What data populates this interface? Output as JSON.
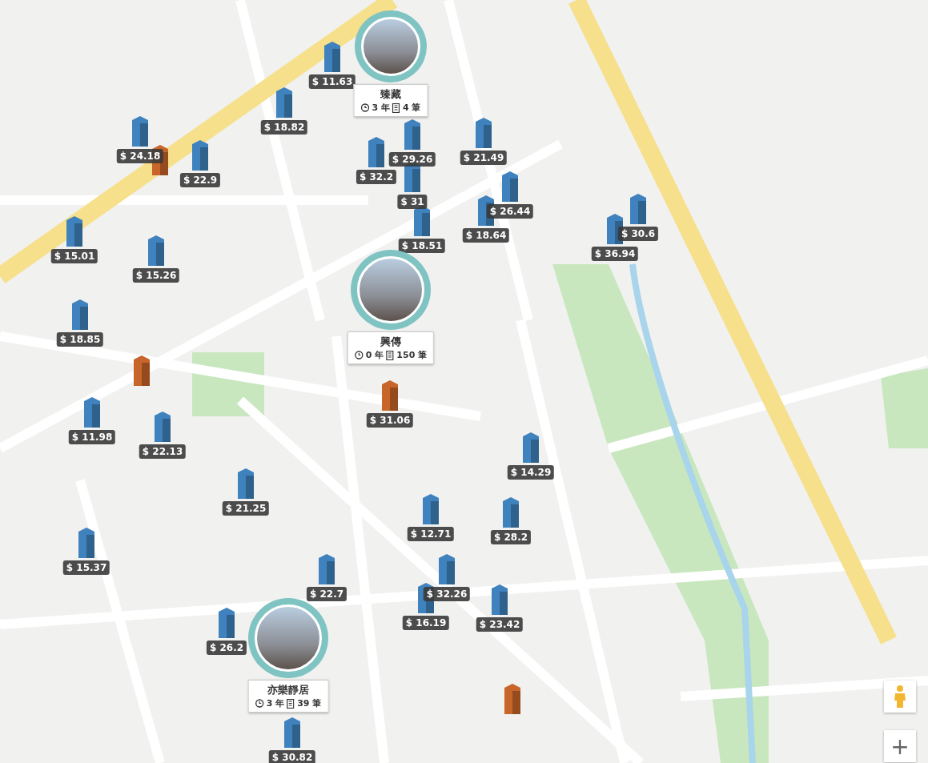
{
  "price_markers": [
    {
      "price": "$ 11.63",
      "color": "#3f82bd"
    },
    {
      "price": "$ 18.82",
      "color": "#3f82bd"
    },
    {
      "price": "$ 24.18",
      "color": "#3f82bd"
    },
    {
      "price": "$ 29.26",
      "color": "#3f82bd"
    },
    {
      "price": "$ 21.49",
      "color": "#3f82bd"
    },
    {
      "price": "$ 22.9",
      "color": "#3f82bd"
    },
    {
      "color": "#c8652a"
    },
    {
      "price": "$ 32.2",
      "color": "#3f82bd"
    },
    {
      "price": "$ 31",
      "color": "#3f82bd"
    },
    {
      "price": "$ 26.44",
      "color": "#3f82bd"
    },
    {
      "price": "$ 18.64",
      "color": "#3f82bd"
    },
    {
      "price": "$ 18.51",
      "color": "#3f82bd"
    },
    {
      "price": "$ 30.6",
      "color": "#3f82bd"
    },
    {
      "price": "$ 36.94",
      "color": "#3f82bd"
    },
    {
      "price": "$ 15.01",
      "color": "#3f82bd"
    },
    {
      "price": "$ 15.26",
      "color": "#3f82bd"
    },
    {
      "price": "$ 18.85",
      "color": "#3f82bd"
    },
    {
      "color": "#c8652a"
    },
    {
      "price": "$ 11.98",
      "color": "#3f82bd"
    },
    {
      "price": "$ 22.13",
      "color": "#3f82bd"
    },
    {
      "price": "$ 31.06",
      "color": "#c8652a"
    },
    {
      "price": "$ 14.29",
      "color": "#3f82bd"
    },
    {
      "price": "$ 21.25",
      "color": "#3f82bd"
    },
    {
      "price": "$ 12.71",
      "color": "#3f82bd"
    },
    {
      "price": "$ 28.2",
      "color": "#3f82bd"
    },
    {
      "price": "$ 15.37",
      "color": "#3f82bd"
    },
    {
      "price": "$ 22.7",
      "color": "#3f82bd"
    },
    {
      "price": "$ 32.26",
      "color": "#3f82bd"
    },
    {
      "price": "$ 16.19",
      "color": "#3f82bd"
    },
    {
      "price": "$ 23.42",
      "color": "#3f82bd"
    },
    {
      "price": "$ 26.2",
      "color": "#3f82bd"
    },
    {
      "price": "$ 30.82",
      "color": "#3f82bd"
    },
    {
      "color": "#c8652a"
    }
  ],
  "project_pins": [
    {
      "name": "臻藏",
      "age": "3 年",
      "listings": "4 筆"
    },
    {
      "name": "興傳",
      "age": "0 年",
      "listings": "150 筆"
    },
    {
      "name": "亦樂靜居",
      "age": "3 年",
      "listings": "39 筆"
    }
  ],
  "map_controls": {
    "zoom_in": "+"
  }
}
